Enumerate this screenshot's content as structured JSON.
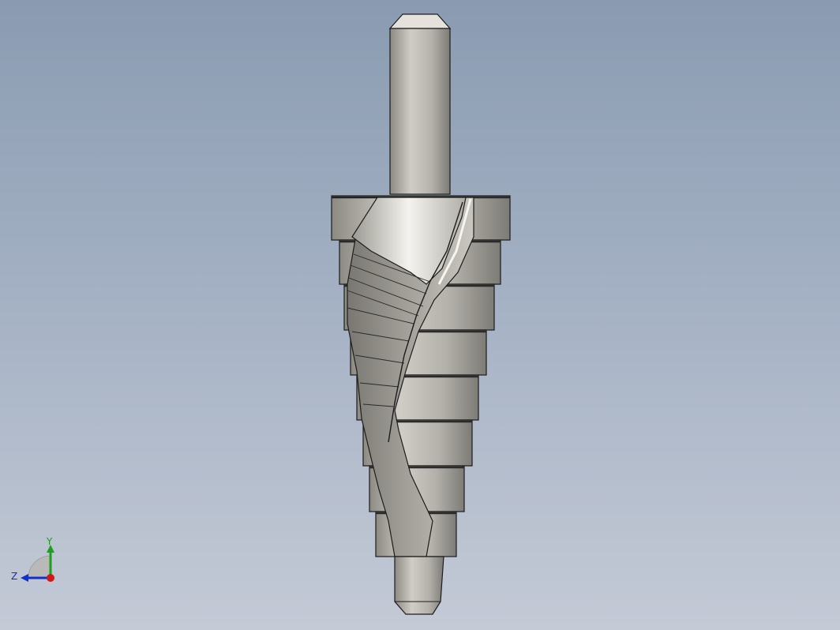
{
  "viewport": {
    "background_top": "#8a9bb1",
    "background_bottom": "#c4cad6"
  },
  "model": {
    "name": "step drill bit",
    "colors": {
      "metal_light": "#d6d4cc",
      "metal_mid": "#a8a69e",
      "metal_dark": "#6f6d67",
      "edge": "#1c1c1c",
      "highlight": "#f2f1ec"
    }
  },
  "triad": {
    "x_label": "",
    "y_label": "Y",
    "z_label": "Z",
    "colors": {
      "x": "#d01818",
      "y": "#1aa01a",
      "z": "#1030c8"
    }
  }
}
